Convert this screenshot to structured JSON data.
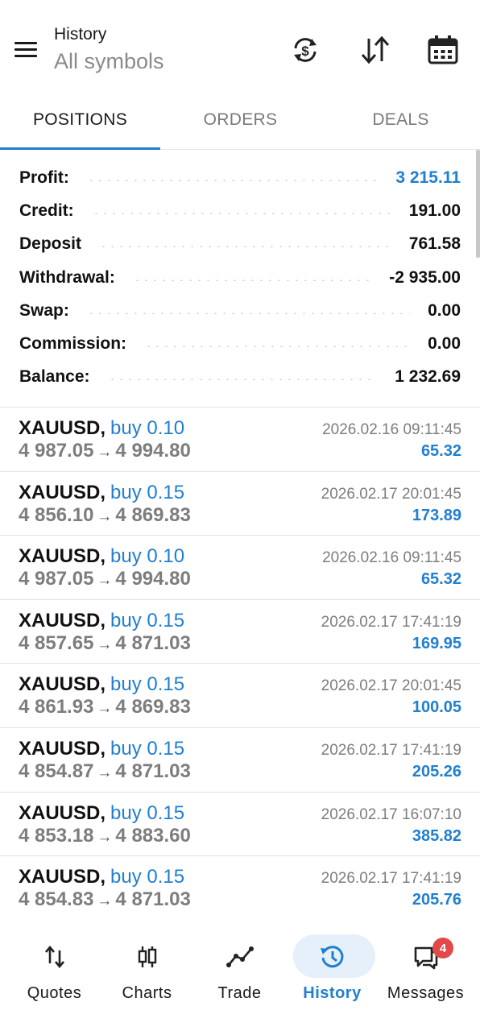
{
  "header": {
    "title": "History",
    "subtitle": "All symbols",
    "icons": [
      "currency-exchange-icon",
      "sort-icon",
      "calendar-icon"
    ]
  },
  "tabs": [
    {
      "label": "POSITIONS",
      "active": true
    },
    {
      "label": "ORDERS",
      "active": false
    },
    {
      "label": "DEALS",
      "active": false
    }
  ],
  "summary": [
    {
      "label": "Profit:",
      "value": "3 215.11",
      "highlight": true
    },
    {
      "label": "Credit:",
      "value": "191.00"
    },
    {
      "label": "Deposit",
      "value": "761.58"
    },
    {
      "label": "Withdrawal:",
      "value": "-2 935.00"
    },
    {
      "label": "Swap:",
      "value": "0.00"
    },
    {
      "label": "Commission:",
      "value": "0.00"
    },
    {
      "label": "Balance:",
      "value": "1 232.69"
    }
  ],
  "deals": [
    {
      "symbol": "XAUUSD,",
      "side": "buy 0.10",
      "open": "4 987.05",
      "arrow": "→",
      "close": "4 994.80",
      "time": "2026.02.16 09:11:45",
      "profit": "65.32"
    },
    {
      "symbol": "XAUUSD,",
      "side": "buy 0.15",
      "open": "4 856.10",
      "arrow": "→",
      "close": "4 869.83",
      "time": "2026.02.17 20:01:45",
      "profit": "173.89"
    },
    {
      "symbol": "XAUUSD,",
      "side": "buy 0.10",
      "open": "4 987.05",
      "arrow": "→",
      "close": "4 994.80",
      "time": "2026.02.16 09:11:45",
      "profit": "65.32"
    },
    {
      "symbol": "XAUUSD,",
      "side": "buy 0.15",
      "open": "4 857.65",
      "arrow": "→",
      "close": "4 871.03",
      "time": "2026.02.17 17:41:19",
      "profit": "169.95"
    },
    {
      "symbol": "XAUUSD,",
      "side": "buy 0.15",
      "open": "4 861.93",
      "arrow": "→",
      "close": "4 869.83",
      "time": "2026.02.17 20:01:45",
      "profit": "100.05"
    },
    {
      "symbol": "XAUUSD,",
      "side": "buy 0.15",
      "open": "4 854.87",
      "arrow": "→",
      "close": "4 871.03",
      "time": "2026.02.17 17:41:19",
      "profit": "205.26"
    },
    {
      "symbol": "XAUUSD,",
      "side": "buy 0.15",
      "open": "4 853.18",
      "arrow": "→",
      "close": "4 883.60",
      "time": "2026.02.17 16:07:10",
      "profit": "385.82"
    },
    {
      "symbol": "XAUUSD,",
      "side": "buy 0.15",
      "open": "4 854.83",
      "arrow": "→",
      "close": "4 871.03",
      "time": "2026.02.17 17:41:19",
      "profit": "205.76"
    }
  ],
  "nav": [
    {
      "label": "Quotes",
      "icon": "quotes-icon"
    },
    {
      "label": "Charts",
      "icon": "charts-icon"
    },
    {
      "label": "Trade",
      "icon": "trade-icon"
    },
    {
      "label": "History",
      "icon": "history-icon",
      "active": true
    },
    {
      "label": "Messages",
      "icon": "messages-icon",
      "badge": "4"
    }
  ],
  "colors": {
    "accent": "#1f7fd0",
    "muted": "#7d7d7d",
    "badge": "#e24a4a"
  }
}
